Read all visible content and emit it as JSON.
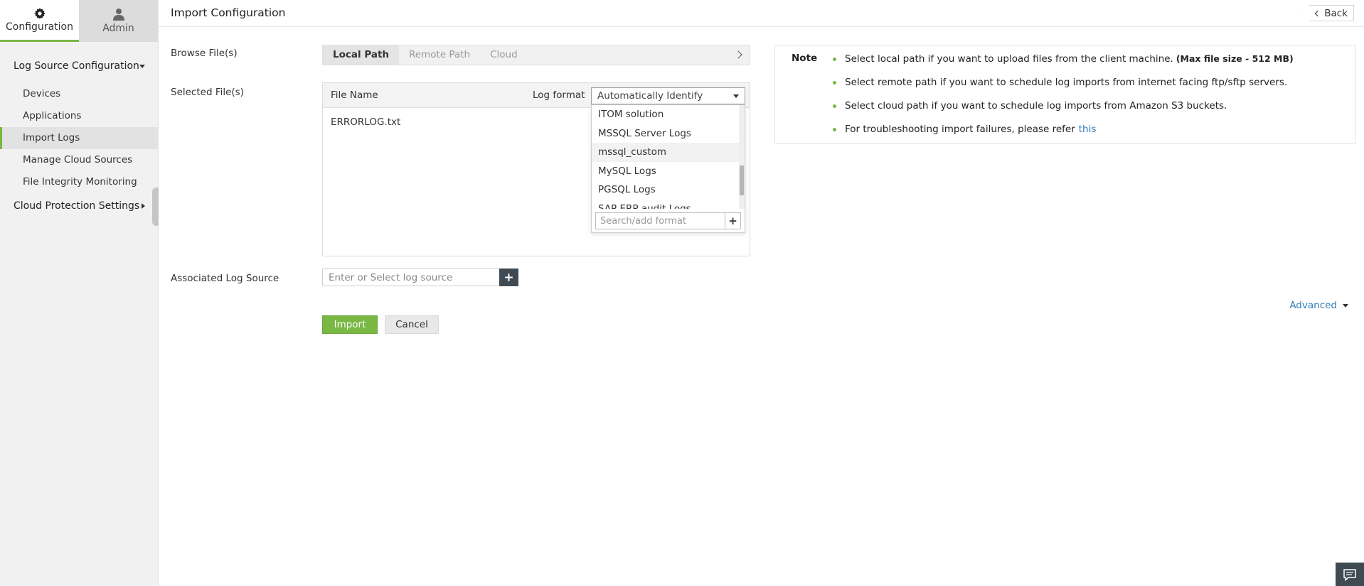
{
  "sidebar": {
    "top_tabs": [
      {
        "label": "Configuration",
        "icon": "gear-icon"
      },
      {
        "label": "Admin",
        "icon": "user-icon"
      }
    ],
    "groups": [
      {
        "label": "Log Source Configuration",
        "items": [
          "Devices",
          "Applications",
          "Import Logs",
          "Manage Cloud Sources",
          "File Integrity Monitoring"
        ]
      },
      {
        "label": "Cloud Protection Settings"
      }
    ],
    "active_item": "Import Logs"
  },
  "header": {
    "title": "Import Configuration",
    "back_label": "Back"
  },
  "form": {
    "browse_label": "Browse File(s)",
    "path_tabs": [
      "Local Path",
      "Remote Path",
      "Cloud"
    ],
    "selected_label": "Selected File(s)",
    "file_name_header": "File Name",
    "log_format_header": "Log format",
    "log_format_value": "Automatically Identify",
    "files": [
      "ERRORLOG.txt"
    ],
    "associated_label": "Associated Log Source",
    "associated_placeholder": "Enter or Select log source",
    "advanced_label": "Advanced",
    "import_label": "Import",
    "cancel_label": "Cancel"
  },
  "format_dropdown": {
    "options": [
      "ITOM solution",
      "MSSQL Server Logs",
      "mssql_custom",
      "MySQL Logs",
      "PGSQL Logs",
      "SAP ERP audit Logs"
    ],
    "hovered": "mssql_custom",
    "search_placeholder": "Search/add format"
  },
  "note": {
    "title": "Note",
    "items": [
      {
        "text": "Select local path if you want to upload files from the client machine.",
        "bold": "(Max file size - 512 MB)"
      },
      {
        "text": "Select remote path if you want to schedule log imports from internet facing ftp/sftp servers."
      },
      {
        "text": "Select cloud path if you want to schedule log imports from Amazon S3 buckets."
      },
      {
        "text": "For troubleshooting import failures, please refer",
        "link": "this"
      }
    ]
  },
  "colors": {
    "accent": "#78b843",
    "link": "#2f7dbb",
    "dark_button": "#3f4a53"
  }
}
